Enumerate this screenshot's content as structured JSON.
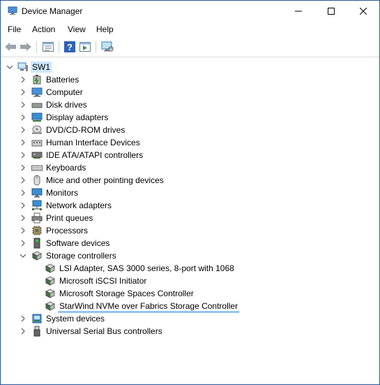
{
  "window": {
    "title": "Device Manager"
  },
  "menu": {
    "file": "File",
    "action": "Action",
    "view": "View",
    "help": "Help"
  },
  "tree": {
    "root": "SW1",
    "categories": {
      "batteries": "Batteries",
      "computer": "Computer",
      "disk_drives": "Disk drives",
      "display_adapters": "Display adapters",
      "dvd": "DVD/CD-ROM drives",
      "hid": "Human Interface Devices",
      "ide": "IDE ATA/ATAPI controllers",
      "keyboards": "Keyboards",
      "mice": "Mice and other pointing devices",
      "monitors": "Monitors",
      "network": "Network adapters",
      "print_queues": "Print queues",
      "processors": "Processors",
      "software": "Software devices",
      "storage": "Storage controllers",
      "system": "System devices",
      "usb": "Universal Serial Bus controllers"
    },
    "storage_children": [
      "LSI Adapter, SAS 3000 series, 8-port with 1068",
      "Microsoft iSCSI Initiator",
      "Microsoft Storage Spaces Controller",
      "StarWind NVMe over Fabrics Storage Controller"
    ]
  },
  "colors": {
    "accent": "#0078d7",
    "selection": "#cce8ff"
  },
  "icons": [
    "back-icon",
    "forward-icon",
    "properties-icon",
    "help-icon",
    "run-icon",
    "monitor-scan-icon"
  ]
}
